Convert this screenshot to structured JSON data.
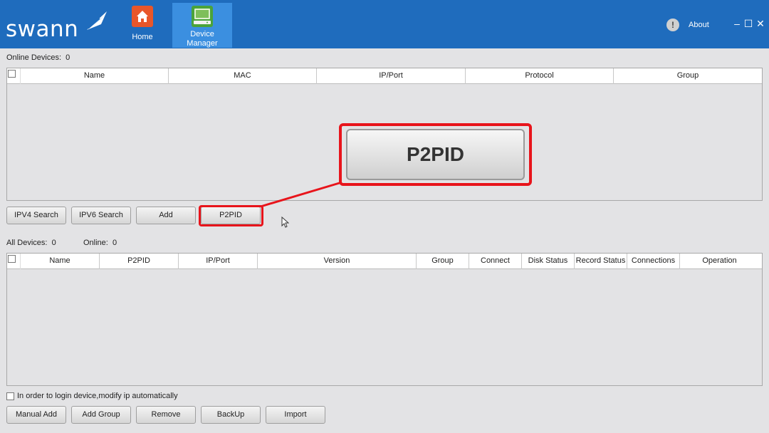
{
  "header": {
    "logo_text": "swann",
    "tabs": [
      {
        "label": "Home",
        "icon": "home-icon"
      },
      {
        "label": "Device\nManager",
        "label_line1": "Device",
        "label_line2": "Manager",
        "icon": "device-manager-icon"
      }
    ],
    "about_label": "About",
    "window_controls": {
      "minimize": "–",
      "maximize": "☐",
      "close": "✕"
    }
  },
  "online_devices": {
    "label": "Online Devices:",
    "count": "0",
    "columns": [
      "Name",
      "MAC",
      "IP/Port",
      "Protocol",
      "Group"
    ]
  },
  "search_buttons": {
    "ipv4": "IPV4 Search",
    "ipv6": "IPV6 Search",
    "add": "Add",
    "p2pid": "P2PID"
  },
  "callout": {
    "label": "P2PID"
  },
  "all_devices": {
    "label": "All Devices:",
    "count": "0",
    "online_label": "Online:",
    "online_count": "0",
    "columns": [
      "Name",
      "P2PID",
      "IP/Port",
      "Version",
      "Group",
      "Connect",
      "Disk Status",
      "Record Status",
      "Connections",
      "Operation"
    ]
  },
  "auto_modify_label": "In order to login device,modify ip automatically",
  "bottom_buttons": {
    "manual_add": "Manual Add",
    "add_group": "Add Group",
    "remove": "Remove",
    "backup": "BackUp",
    "import": "Import"
  },
  "colors": {
    "header_bg": "#1f6cbd",
    "active_tab_bg": "#3b8fe0",
    "highlight_red": "#e8141b",
    "body_bg": "#e3e3e5"
  }
}
